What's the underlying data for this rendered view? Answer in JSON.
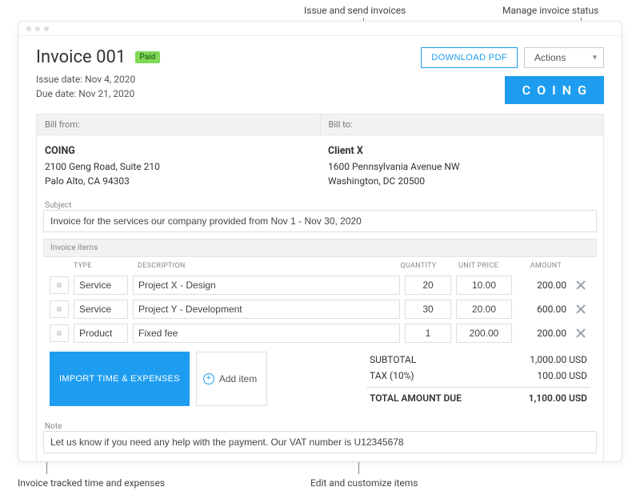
{
  "annotations": {
    "issue_send": "Issue and send invoices",
    "manage_status": "Manage invoice status",
    "tracked_time": "Invoice tracked time and expenses",
    "edit_items": "Edit and customize items"
  },
  "header": {
    "title": "Invoice 001",
    "badge": "Paid",
    "issue_date_label": "Issue date: Nov 4, 2020",
    "due_date_label": "Due date: Nov 21, 2020",
    "download_pdf": "DOWNLOAD PDF",
    "actions": "Actions",
    "brand": "COING"
  },
  "bill": {
    "from_label": "Bill from:",
    "to_label": "Bill to:",
    "from": {
      "name": "COING",
      "line1": "2100 Geng Road, Suite 210",
      "line2": "Palo Alto, CA 94303"
    },
    "to": {
      "name": "Client X",
      "line1": "1600 Pennsylvania Avenue NW",
      "line2": "Washington, DC 20500"
    }
  },
  "subject": {
    "label": "Subject",
    "value": "Invoice for the services our company provided from Nov 1 - Nov 30, 2020"
  },
  "items": {
    "section_label": "Invoice items",
    "cols": {
      "type": "TYPE",
      "description": "DESCRIPTION",
      "quantity": "QUANTITY",
      "unit_price": "UNIT PRICE",
      "amount": "AMOUNT"
    },
    "rows": [
      {
        "type": "Service",
        "description": "Project X - Design",
        "quantity": "20",
        "unit_price": "10.00",
        "amount": "200.00"
      },
      {
        "type": "Service",
        "description": "Project Y - Development",
        "quantity": "30",
        "unit_price": "20.00",
        "amount": "600.00"
      },
      {
        "type": "Product",
        "description": "Fixed fee",
        "quantity": "1",
        "unit_price": "200.00",
        "amount": "200.00"
      }
    ],
    "import_button": "IMPORT TIME & EXPENSES",
    "add_item": "Add item"
  },
  "totals": {
    "subtotal_label": "SUBTOTAL",
    "subtotal_value": "1,000.00 USD",
    "tax_label": "TAX  (10%)",
    "tax_value": "100.00 USD",
    "total_label": "TOTAL AMOUNT DUE",
    "total_value": "1,100.00 USD"
  },
  "note": {
    "label": "Note",
    "value": "Let us know if you need any help with the payment. Our VAT number is U12345678"
  }
}
